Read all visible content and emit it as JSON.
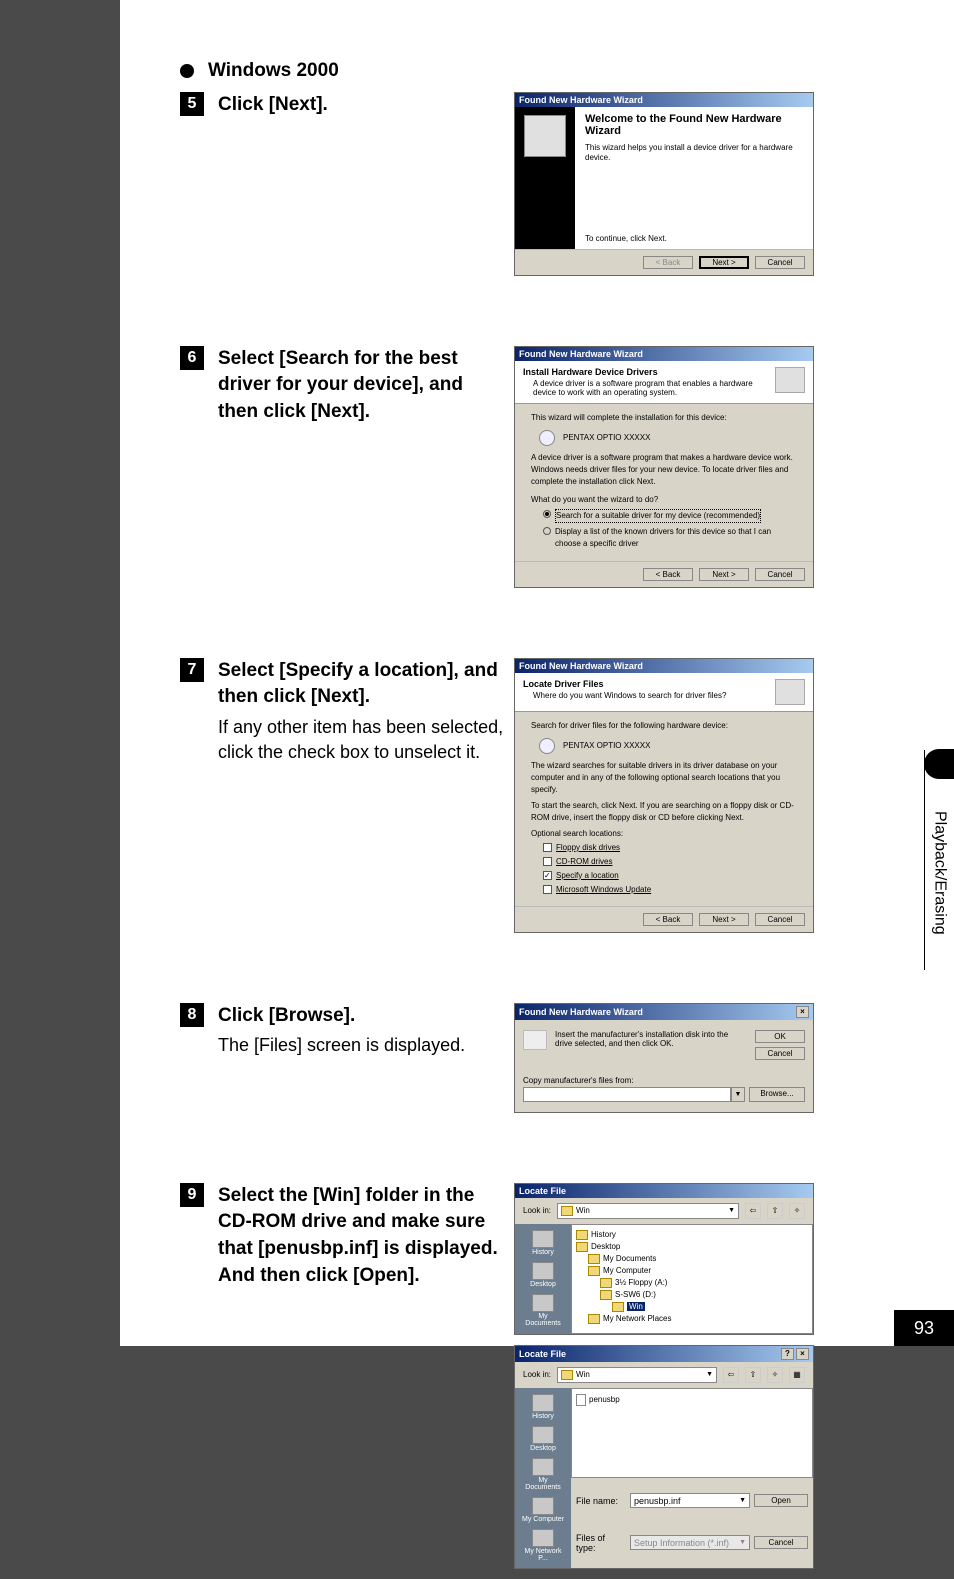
{
  "header": {
    "os": "Windows 2000"
  },
  "steps": {
    "s5": {
      "num": "5",
      "head": "Click [Next]."
    },
    "s6": {
      "num": "6",
      "head": "Select [Search for the best driver for your device], and then click [Next]."
    },
    "s7": {
      "num": "7",
      "head": "Select [Specify a location], and then click [Next].",
      "body": "If any other item has been selected, click the check box to unselect it."
    },
    "s8": {
      "num": "8",
      "head": "Click [Browse].",
      "body": "The [Files] screen is displayed."
    },
    "s9": {
      "num": "9",
      "head": "Select the [Win] folder in the CD-ROM drive and make sure that [penusbp.inf] is displayed. And then click [Open]."
    }
  },
  "dlg_common": {
    "wizard_title": "Found New Hardware Wizard",
    "back": "< Back",
    "next": "Next >",
    "cancel": "Cancel",
    "ok": "OK",
    "browse": "Browse...",
    "open": "Open"
  },
  "dlg1": {
    "heading": "Welcome to the Found New Hardware Wizard",
    "sub": "This wizard helps you install a device driver for a hardware device.",
    "cont": "To continue, click Next."
  },
  "dlg2": {
    "heading": "Install Hardware Device Drivers",
    "sub": "A device driver is a software program that enables a hardware device to work with an operating system.",
    "line1": "This wizard will complete the installation for this device:",
    "device": "PENTAX OPTIO XXXXX",
    "line2": "A device driver is a software program that makes a hardware device work. Windows needs driver files for your new device. To locate driver files and complete the installation click Next.",
    "line3": "What do you want the wizard to do?",
    "opt1": "Search for a suitable driver for my device (recommended)",
    "opt2": "Display a list of the known drivers for this device so that I can choose a specific driver"
  },
  "dlg3": {
    "heading": "Locate Driver Files",
    "sub": "Where do you want Windows to search for driver files?",
    "line1": "Search for driver files for the following hardware device:",
    "device": "PENTAX OPTIO XXXXX",
    "line2": "The wizard searches for suitable drivers in its driver database on your computer and in any of the following optional search locations that you specify.",
    "line3": "To start the search, click Next. If you are searching on a floppy disk or CD-ROM drive, insert the floppy disk or CD before clicking Next.",
    "line4": "Optional search locations:",
    "chk1": "Floppy disk drives",
    "chk2": "CD-ROM drives",
    "chk3": "Specify a location",
    "chk4": "Microsoft Windows Update"
  },
  "dlg4": {
    "msg": "Insert the manufacturer's installation disk into the drive selected, and then click OK.",
    "copy": "Copy manufacturer's files from:"
  },
  "dlg5": {
    "title": "Locate File",
    "lookin": "Look in:",
    "folder": "Win",
    "tree": {
      "history": "History",
      "desktop": "Desktop",
      "mydocs": "My Documents",
      "mycomp": "My Computer",
      "floppy": "3½ Floppy (A:)",
      "cdrom": "S-SW6 (D:)",
      "win": "Win",
      "netplaces": "My Network Places"
    },
    "sb": {
      "history": "History",
      "desktop": "Desktop",
      "mydocs": "My Documents",
      "mycomp": "My Computer",
      "mynet": "My Network P..."
    }
  },
  "dlg6": {
    "title": "Locate File",
    "lookin": "Look in:",
    "folder": "Win",
    "file": "penusbp",
    "filename_label": "File name:",
    "filename_value": "penusbp.inf",
    "filetype_label": "Files of type:",
    "filetype_value": "Setup Information (*.inf)"
  },
  "side": {
    "label": "Playback/Erasing"
  },
  "page_num": "93"
}
